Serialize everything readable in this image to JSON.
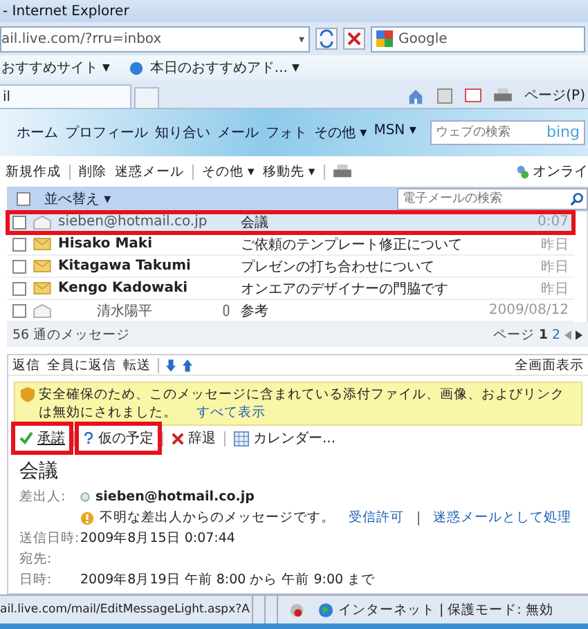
{
  "window": {
    "title": "- Internet Explorer"
  },
  "address_bar": {
    "url": "ail.live.com/?rru=inbox",
    "dropdown": "▾",
    "search_engine": "Google"
  },
  "favorites": [
    {
      "label": "おすすめサイト",
      "dropdown": "▼"
    },
    {
      "label": "本日のおすすめアド...",
      "dropdown": "▼"
    }
  ],
  "tab": {
    "label": "il"
  },
  "command_bar": {
    "page_menu": "ページ(P)"
  },
  "site_nav": {
    "links": [
      "ホーム",
      "プロフィール",
      "知り合い",
      "メール",
      "フォト",
      "その他 ▾",
      "MSN ▾"
    ],
    "search_placeholder": "ウェブの検索",
    "logo": "bing"
  },
  "mail_toolbar": {
    "groups": [
      [
        "新規作成"
      ],
      [
        "削除",
        "迷惑メール"
      ],
      [
        "その他 ▾",
        "移動先 ▾"
      ]
    ],
    "status": "オンライ"
  },
  "message_list": {
    "select_all_checked": false,
    "sort_label": "並べ替え ▾",
    "search_placeholder": "電子メールの検索",
    "rows": [
      {
        "sender": "sieben@hotmail.co.jp",
        "subject": "会議",
        "date": "0:07",
        "unread": false,
        "selected": true,
        "highlighted": true,
        "attachment": false
      },
      {
        "sender": "Hisako Maki",
        "subject": "ご依頼のテンプレート修正について",
        "date": "昨日",
        "unread": true,
        "selected": false,
        "highlighted": false,
        "attachment": false
      },
      {
        "sender": "Kitagawa Takumi",
        "subject": "プレゼンの打ち合わせについて",
        "date": "昨日",
        "unread": true,
        "selected": false,
        "highlighted": false,
        "attachment": false
      },
      {
        "sender": "Kengo Kadowaki",
        "subject": "オンエアのデザイナーの門脇です",
        "date": "昨日",
        "unread": true,
        "selected": false,
        "highlighted": false,
        "attachment": false
      },
      {
        "sender": "清水陽平",
        "subject": "参考",
        "date": "2009/08/12",
        "unread": false,
        "selected": false,
        "highlighted": false,
        "attachment": true
      }
    ],
    "count": "56 通のメッセージ",
    "pager": {
      "label": "ページ",
      "pages": [
        {
          "label": "1",
          "selected": true
        },
        {
          "label": "2",
          "selected": false
        }
      ]
    }
  },
  "reading_pane": {
    "actions": [
      "返信",
      "全員に返信",
      "転送"
    ],
    "fullscreen": "全画面表示",
    "warning": {
      "text": "安全確保のため、このメッセージに含まれている添付ファイル、画像、およびリンクは無効にされました。",
      "link": "すべて表示"
    },
    "invite_actions": [
      {
        "kind": "accept",
        "label": "承諾",
        "highlighted": true
      },
      {
        "kind": "tentative",
        "label": "仮の予定",
        "highlighted": true
      },
      {
        "kind": "decline",
        "label": "辞退",
        "highlighted": false
      },
      {
        "kind": "calendar",
        "label": "カレンダー...",
        "highlighted": false
      }
    ],
    "subject": "会議",
    "fields": [
      {
        "kind": "sender",
        "label": "差出人:",
        "value": "sieben@hotmail.co.jp"
      },
      {
        "kind": "notice",
        "text": "不明な差出人からのメッセージです。",
        "links": [
          "受信許可",
          "迷惑メールとして処理"
        ]
      },
      {
        "kind": "plain",
        "label": "送信日時:",
        "value": "2009年8月15日 0:07:44"
      },
      {
        "kind": "plain",
        "label": "宛先:"
      },
      {
        "kind": "plain",
        "label": "日時:",
        "value": "2009年8月19日 午前 8:00 から 午前 9:00 まで"
      }
    ]
  },
  "status_bar": {
    "url": "ail.live.com/mail/EditMessageLight.aspx?A",
    "zone": "インターネット | 保護モード: 無効"
  }
}
